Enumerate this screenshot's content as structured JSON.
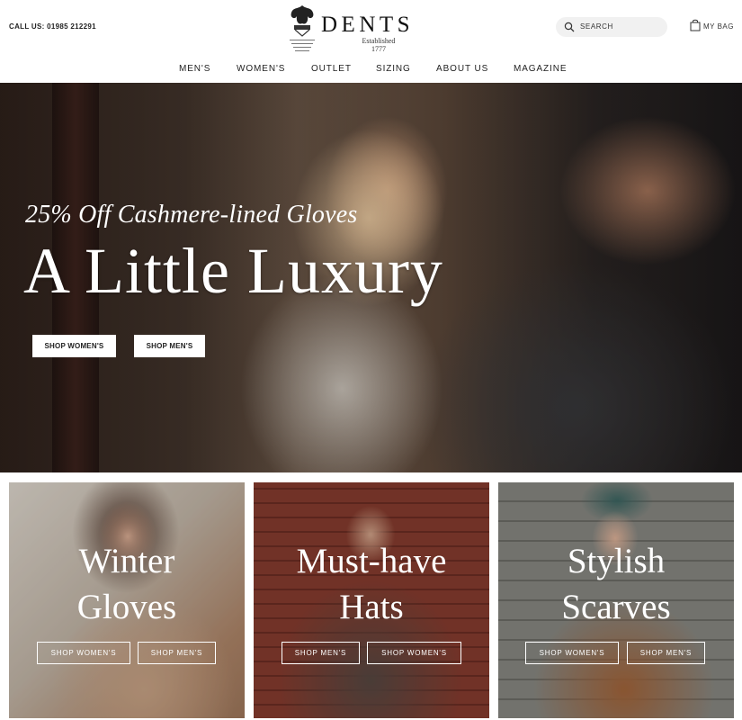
{
  "header": {
    "call_us": "CALL US: 01985 212291",
    "brand": "DENTS",
    "established_label": "Established",
    "established_year": "1777",
    "search_placeholder": "SEARCH",
    "bag_label": "MY BAG"
  },
  "nav": {
    "items": [
      "MEN'S",
      "WOMEN'S",
      "OUTLET",
      "SIZING",
      "ABOUT US",
      "MAGAZINE"
    ]
  },
  "hero": {
    "subtitle": "25% Off Cashmere-lined Gloves",
    "title": "A Little Luxury",
    "buttons": [
      "SHOP WOMEN'S",
      "SHOP MEN'S"
    ]
  },
  "tiles": [
    {
      "line1": "Winter",
      "line2": "Gloves",
      "buttons": [
        "SHOP WOMEN'S",
        "SHOP MEN'S"
      ]
    },
    {
      "line1": "Must-have",
      "line2": "Hats",
      "buttons": [
        "SHOP MEN'S",
        "SHOP WOMEN'S"
      ]
    },
    {
      "line1": "Stylish",
      "line2": "Scarves",
      "buttons": [
        "SHOP WOMEN'S",
        "SHOP MEN'S"
      ]
    }
  ],
  "icons": {
    "search": "search-icon",
    "bag": "shopping-bag-icon",
    "crest": "crest-icon"
  }
}
